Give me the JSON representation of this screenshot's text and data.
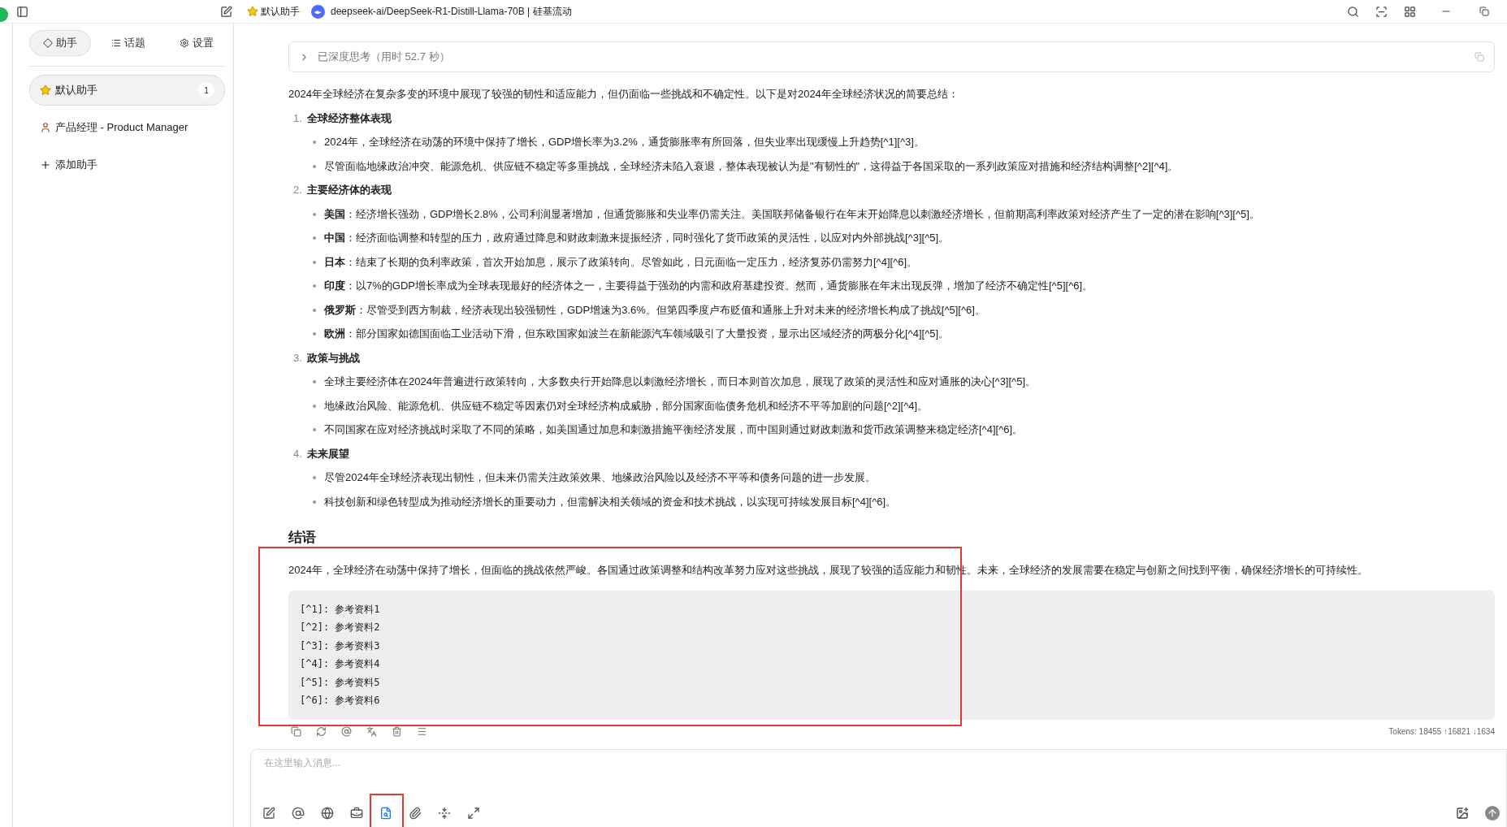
{
  "titlebar": {
    "assistant": "默认助手",
    "model": "deepseek-ai/DeepSeek-R1-Distill-Llama-70B | 硅基流动"
  },
  "sidebar": {
    "tabs": [
      {
        "kind": "assistant",
        "label": "助手",
        "selected": true
      },
      {
        "kind": "topics",
        "label": "话题",
        "selected": false
      },
      {
        "kind": "settings",
        "label": "设置",
        "selected": false
      }
    ],
    "assistants": [
      {
        "kind": "star",
        "name": "默认助手",
        "count": "1",
        "selected": true
      },
      {
        "kind": "person",
        "name": "产品经理 - Product Manager",
        "selected": false
      }
    ],
    "add_label": "添加助手"
  },
  "message": {
    "thinking": {
      "label": "已深度思考（用时 52.7 秒）",
      "expanded": false
    },
    "intro": "2024年全球经济在复杂多变的环境中展现了较强的韧性和适应能力，但仍面临一些挑战和不确定性。以下是对2024年全球经济状况的简要总结：",
    "sections": [
      {
        "number": "1.",
        "title": "全球经济整体表现",
        "bullets": [
          "2024年，全球经济在动荡的环境中保持了增长，GDP增长率为3.2%，通货膨胀率有所回落，但失业率出现缓慢上升趋势[^1][^3]。",
          "尽管面临地缘政治冲突、能源危机、供应链不稳定等多重挑战，全球经济未陷入衰退，整体表现被认为是\"有韧性的\"，这得益于各国采取的一系列政策应对措施和经济结构调整[^2][^4]。"
        ]
      },
      {
        "number": "2.",
        "title": "主要经济体的表现",
        "bullets": [
          "**美国**：经济增长强劲，GDP增长2.8%，公司利润显著增加，但通货膨胀和失业率仍需关注。美国联邦储备银行在年末开始降息以刺激经济增长，但前期高利率政策对经济产生了一定的潜在影响[^3][^5]。",
          "**中国**：经济面临调整和转型的压力，政府通过降息和财政刺激来提振经济，同时强化了货币政策的灵活性，以应对内外部挑战[^3][^5]。",
          "**日本**：结束了长期的负利率政策，首次开始加息，展示了政策转向。尽管如此，日元面临一定压力，经济复苏仍需努力[^4][^6]。",
          "**印度**：以7%的GDP增长率成为全球表现最好的经济体之一，主要得益于强劲的内需和政府基建投资。然而，通货膨胀在年末出现反弹，增加了经济不确定性[^5][^6]。",
          "**俄罗斯**：尽管受到西方制裁，经济表现出较强韧性，GDP增速为3.6%。但第四季度卢布贬值和通胀上升对未来的经济增长构成了挑战[^5][^6]。",
          "**欧洲**：部分国家如德国面临工业活动下滑，但东欧国家如波兰在新能源汽车领域吸引了大量投资，显示出区域经济的两极分化[^4][^5]。"
        ]
      },
      {
        "number": "3.",
        "title": "政策与挑战",
        "bullets": [
          "全球主要经济体在2024年普遍进行政策转向，大多数央行开始降息以刺激经济增长，而日本则首次加息，展现了政策的灵活性和应对通胀的决心[^3][^5]。",
          "地缘政治风险、能源危机、供应链不稳定等因素仍对全球经济构成威胁，部分国家面临债务危机和经济不平等加剧的问题[^2][^4]。",
          "不同国家在应对经济挑战时采取了不同的策略，如美国通过加息和刺激措施平衡经济发展，而中国则通过财政刺激和货币政策调整来稳定经济[^4][^6]。"
        ]
      },
      {
        "number": "4.",
        "title": "未来展望",
        "bullets": [
          "尽管2024年全球经济表现出韧性，但未来仍需关注政策效果、地缘政治风险以及经济不平等和债务问题的进一步发展。",
          "科技创新和绿色转型成为推动经济增长的重要动力，但需解决相关领域的资金和技术挑战，以实现可持续发展目标[^4][^6]。"
        ]
      }
    ],
    "conclusion_heading": "结语",
    "conclusion": "2024年，全球经济在动荡中保持了增长，但面临的挑战依然严峻。各国通过政策调整和结构改革努力应对这些挑战，展现了较强的适应能力和韧性。未来，全球经济的发展需要在稳定与创新之间找到平衡，确保经济增长的可持续性。",
    "code_lines": [
      "[^1]: 参考资料1",
      "[^2]: 参考资料2",
      "[^3]: 参考资料3",
      "[^4]: 参考资料4",
      "[^5]: 参考资料5",
      "[^6]: 参考资料6"
    ],
    "actions": [
      {
        "kind": "copy"
      },
      {
        "kind": "regenerate"
      },
      {
        "kind": "mention"
      },
      {
        "kind": "translate"
      },
      {
        "kind": "delete"
      },
      {
        "kind": "menu"
      }
    ],
    "tokens": "Tokens: 18455 ↑16821 ↓1634"
  },
  "composer": {
    "placeholder": "在这里输入消息...",
    "tools": [
      {
        "kind": "new",
        "selected": false
      },
      {
        "kind": "mention",
        "selected": false
      },
      {
        "kind": "web",
        "selected": false
      },
      {
        "kind": "toolbox",
        "selected": false
      },
      {
        "kind": "knowledge",
        "selected": true
      },
      {
        "kind": "attach",
        "selected": false
      },
      {
        "kind": "fold",
        "selected": false
      },
      {
        "kind": "expand",
        "selected": false
      }
    ]
  }
}
